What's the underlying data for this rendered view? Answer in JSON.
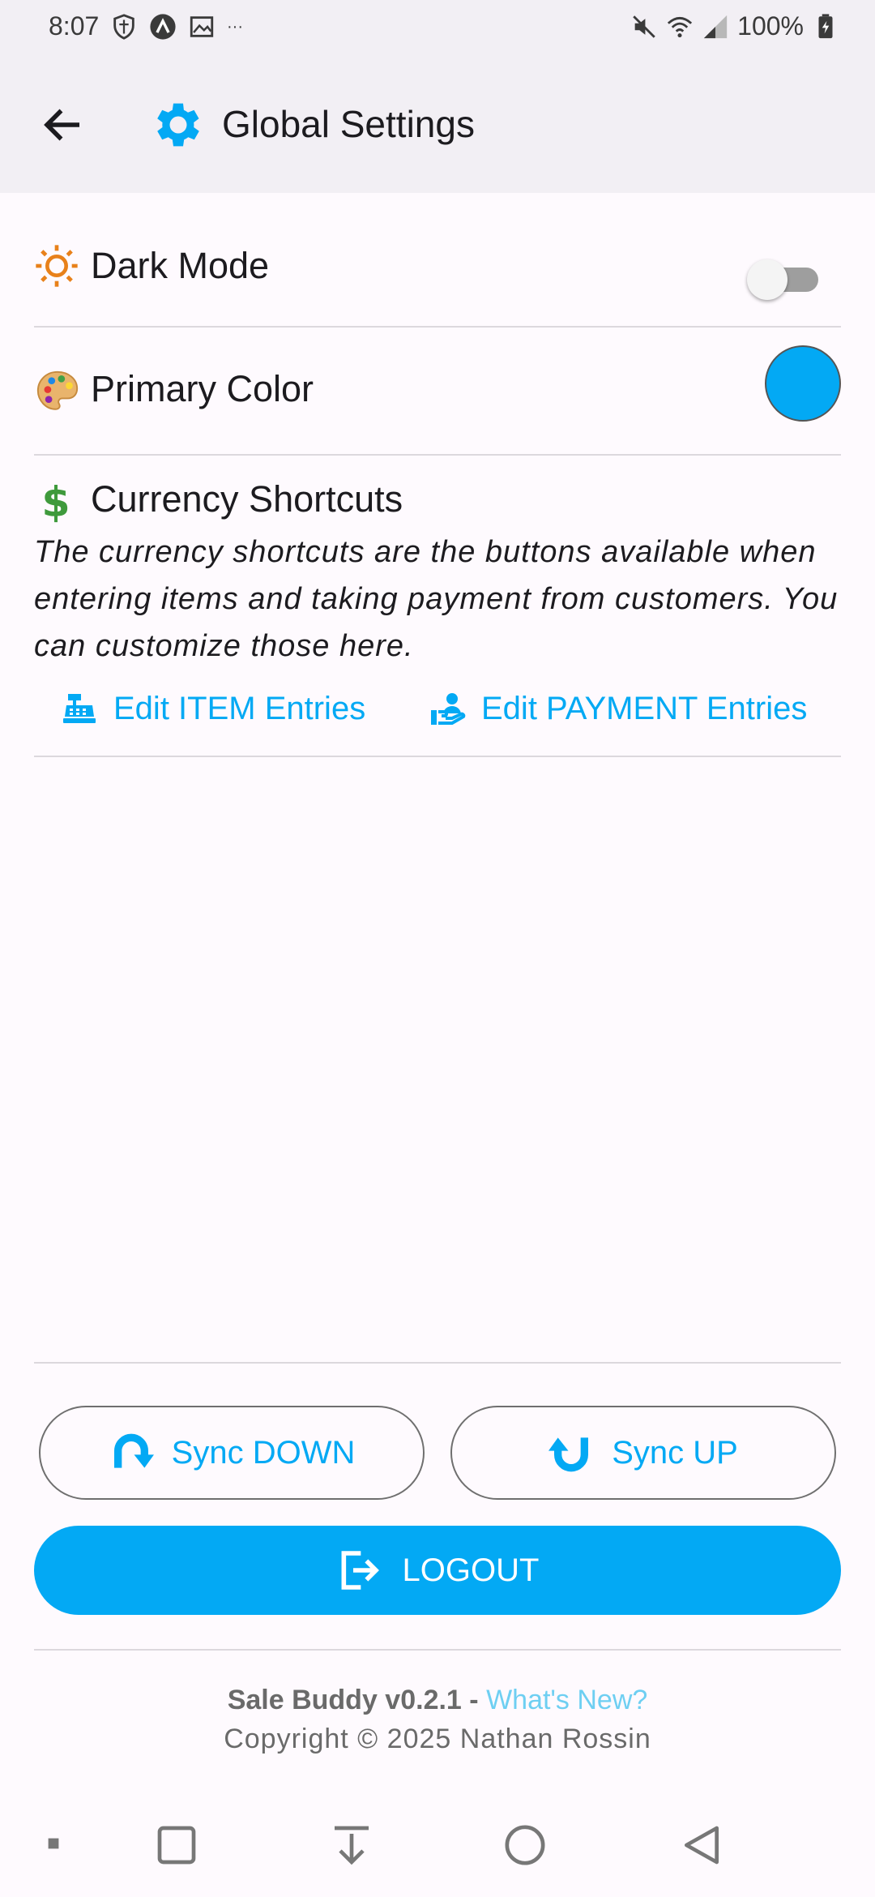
{
  "status_bar": {
    "time": "8:07",
    "overflow": "···",
    "battery": "100%"
  },
  "header": {
    "title": "Global Settings",
    "accent_color": "#03a9f4"
  },
  "settings": {
    "dark_mode_label": "Dark Mode",
    "dark_mode_enabled": false,
    "primary_color_label": "Primary Color",
    "primary_color_value": "#03a9f4",
    "currency_shortcuts_label": "Currency Shortcuts",
    "currency_shortcuts_description": "The currency shortcuts are the buttons available when entering items and taking payment from customers. You can customize those here.",
    "edit_item_entries_label": "Edit ITEM Entries",
    "edit_payment_entries_label": "Edit PAYMENT Entries"
  },
  "actions": {
    "sync_down_label": "Sync DOWN",
    "sync_up_label": "Sync UP",
    "logout_label": "LOGOUT"
  },
  "footer": {
    "app_version": "Sale Buddy v0.2.1",
    "separator": " - ",
    "whats_new_link": "What's New?",
    "copyright": "Copyright © 2025 Nathan Rossin"
  },
  "icons": {
    "back": "arrow-left-icon",
    "title": "gear-icon",
    "dark_mode": "sun-icon",
    "primary_color": "palette-icon",
    "currency": "dollar-sign-icon",
    "edit_item": "cash-register-icon",
    "edit_payment": "hand-holding-user-icon",
    "sync_down": "redo-arrow-icon",
    "sync_up": "rotate-arrow-icon",
    "logout": "logout-icon"
  }
}
